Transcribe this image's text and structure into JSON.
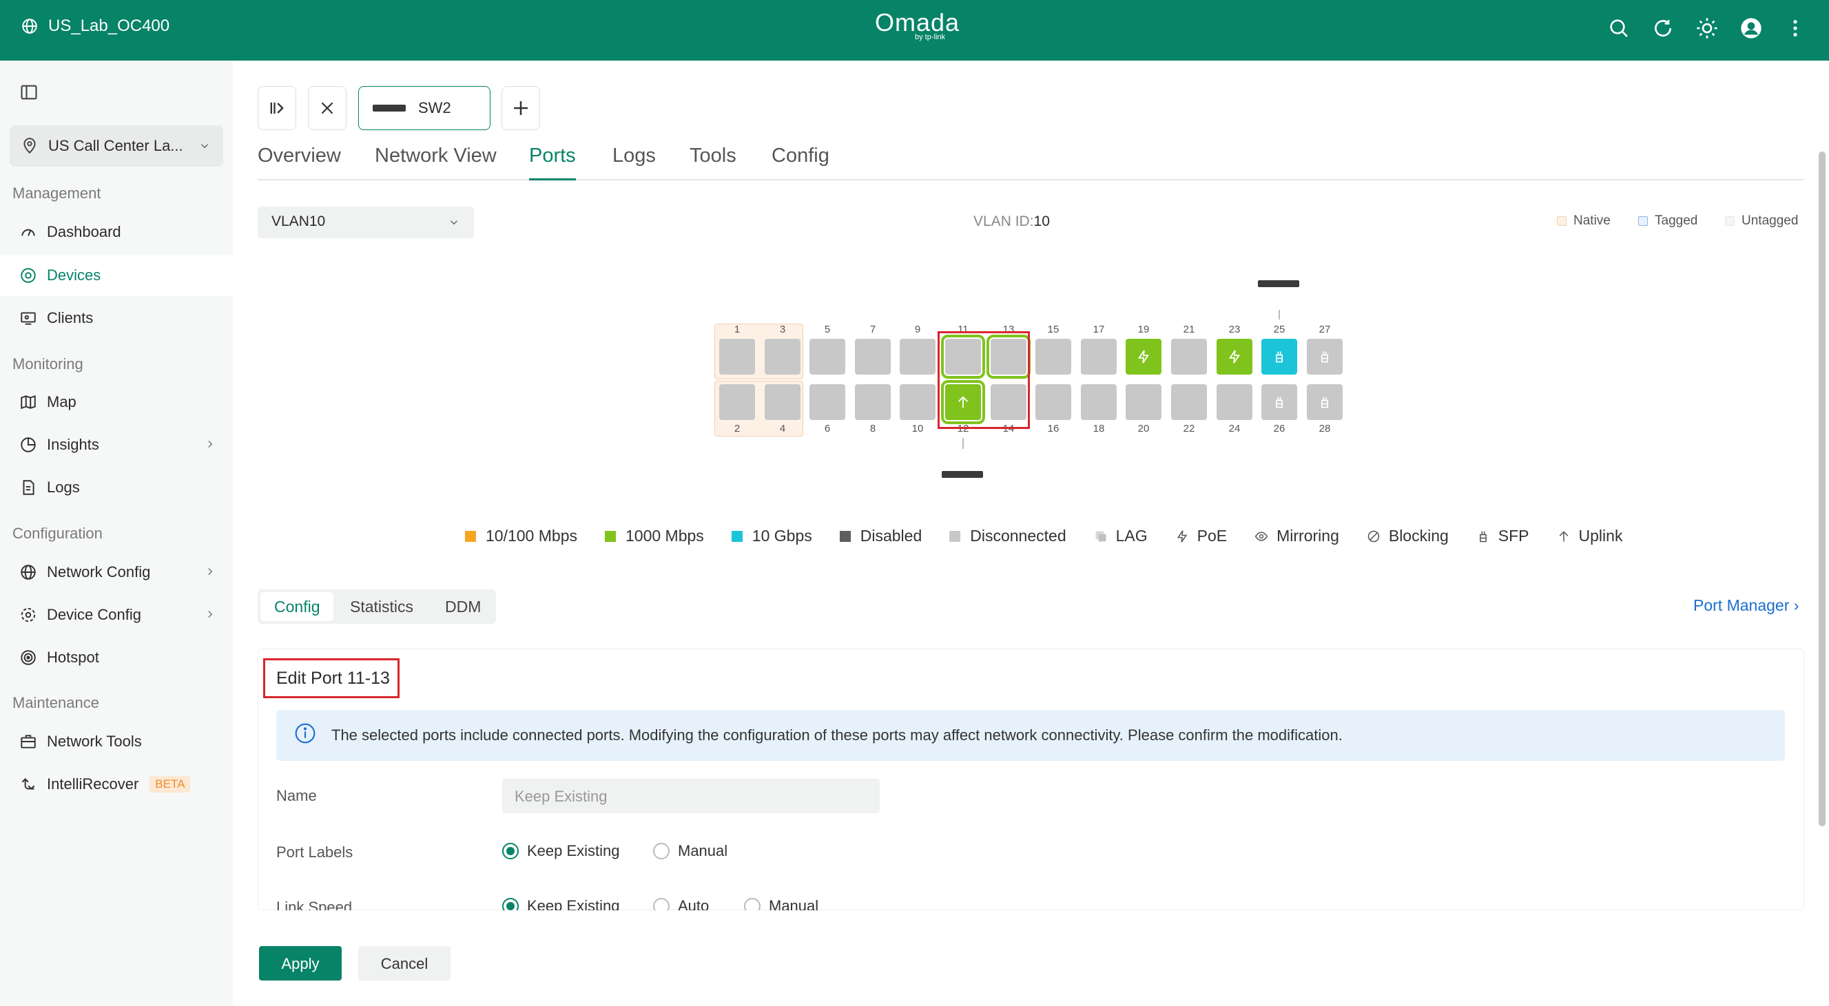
{
  "header": {
    "site_name": "US_Lab_OC400",
    "logo_text": "Omada",
    "logo_sub": "by tp-link",
    "icons": [
      "search-icon",
      "refresh-icon",
      "theme-icon",
      "avatar",
      "more-icon"
    ]
  },
  "sidebar": {
    "site_selector": "US Call Center La...",
    "sections": {
      "management": "Management",
      "monitoring": "Monitoring",
      "configuration": "Configuration",
      "maintenance": "Maintenance"
    },
    "items": {
      "dashboard": "Dashboard",
      "devices": "Devices",
      "clients": "Clients",
      "map": "Map",
      "insights": "Insights",
      "logs": "Logs",
      "network_config": "Network Config",
      "device_config": "Device Config",
      "hotspot": "Hotspot",
      "network_tools": "Network Tools",
      "intellirecover": "IntelliRecover",
      "beta": "BETA"
    }
  },
  "device_tab": {
    "name": "SW2"
  },
  "tabs": {
    "overview": "Overview",
    "network_view": "Network View",
    "ports": "Ports",
    "logs": "Logs",
    "tools": "Tools",
    "config": "Config"
  },
  "vlan": {
    "selected": "VLAN10",
    "id_label": "VLAN ID:",
    "id_value": "10",
    "legend_native": "Native",
    "legend_tagged": "Tagged",
    "legend_untagged": "Untagged"
  },
  "ports": {
    "top_labels": [
      "1",
      "3",
      "5",
      "7",
      "9",
      "11",
      "13",
      "15",
      "17",
      "19",
      "21",
      "23",
      "25",
      "27"
    ],
    "bottom_labels": [
      "2",
      "4",
      "6",
      "8",
      "10",
      "12",
      "14",
      "16",
      "18",
      "20",
      "22",
      "24",
      "26",
      "28"
    ]
  },
  "legend": {
    "speed_100": "10/100 Mbps",
    "speed_1000": "1000 Mbps",
    "speed_10g": "10 Gbps",
    "disabled": "Disabled",
    "disconnected": "Disconnected",
    "lag": "LAG",
    "poe": "PoE",
    "mirroring": "Mirroring",
    "blocking": "Blocking",
    "sfp": "SFP",
    "uplink": "Uplink",
    "colors": {
      "speed_100": "#f5a623",
      "speed_1000": "#7fc31c",
      "speed_10g": "#1cc4d8",
      "disabled": "#5e5e5e",
      "disconnected": "#c8c8c8"
    }
  },
  "subtabs": {
    "config": "Config",
    "statistics": "Statistics",
    "ddm": "DDM"
  },
  "port_manager": "Port Manager ›",
  "edit": {
    "title": "Edit Port 11-13",
    "alert": "The selected ports include connected ports. Modifying the configuration of these ports may affect network connectivity. Please confirm the modification.",
    "name_label": "Name",
    "name_placeholder": "Keep Existing",
    "port_labels_label": "Port Labels",
    "keep_existing": "Keep Existing",
    "manual": "Manual",
    "link_speed_label": "Link Speed",
    "auto": "Auto"
  },
  "buttons": {
    "apply": "Apply",
    "cancel": "Cancel"
  }
}
